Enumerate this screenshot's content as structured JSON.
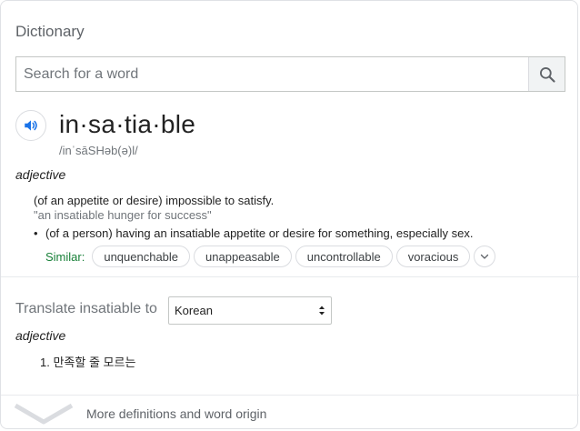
{
  "header": {
    "title": "Dictionary"
  },
  "search": {
    "placeholder": "Search for a word",
    "value": "",
    "button_icon": "search-icon"
  },
  "entry": {
    "word": "in·sa·tia·ble",
    "pronunciation": "/inˈsāSHəb(ə)l/",
    "audio_icon": "speaker-icon",
    "part_of_speech": "adjective",
    "definitions": [
      {
        "text": "(of an appetite or desire) impossible to satisfy.",
        "example": "\"an insatiable hunger for success\""
      },
      {
        "bullet": "•",
        "text": "(of a person) having an insatiable appetite or desire for something, especially sex."
      }
    ],
    "similar": {
      "label": "Similar:",
      "words": [
        "unquenchable",
        "unappeasable",
        "uncontrollable",
        "voracious"
      ],
      "more_icon": "chevron-down-icon"
    }
  },
  "translate": {
    "label": "Translate insatiable to",
    "selected_language": "Korean",
    "part_of_speech": "adjective",
    "items": [
      {
        "index": "1.",
        "text": "만족할 줄 모르는"
      }
    ]
  },
  "footer": {
    "more_label": "More definitions and word origin",
    "icon": "chevron-down-icon"
  },
  "colors": {
    "accent_blue": "#1a73e8",
    "similar_green": "#188038",
    "muted_text": "#70757a",
    "border": "#dfe1e5"
  }
}
